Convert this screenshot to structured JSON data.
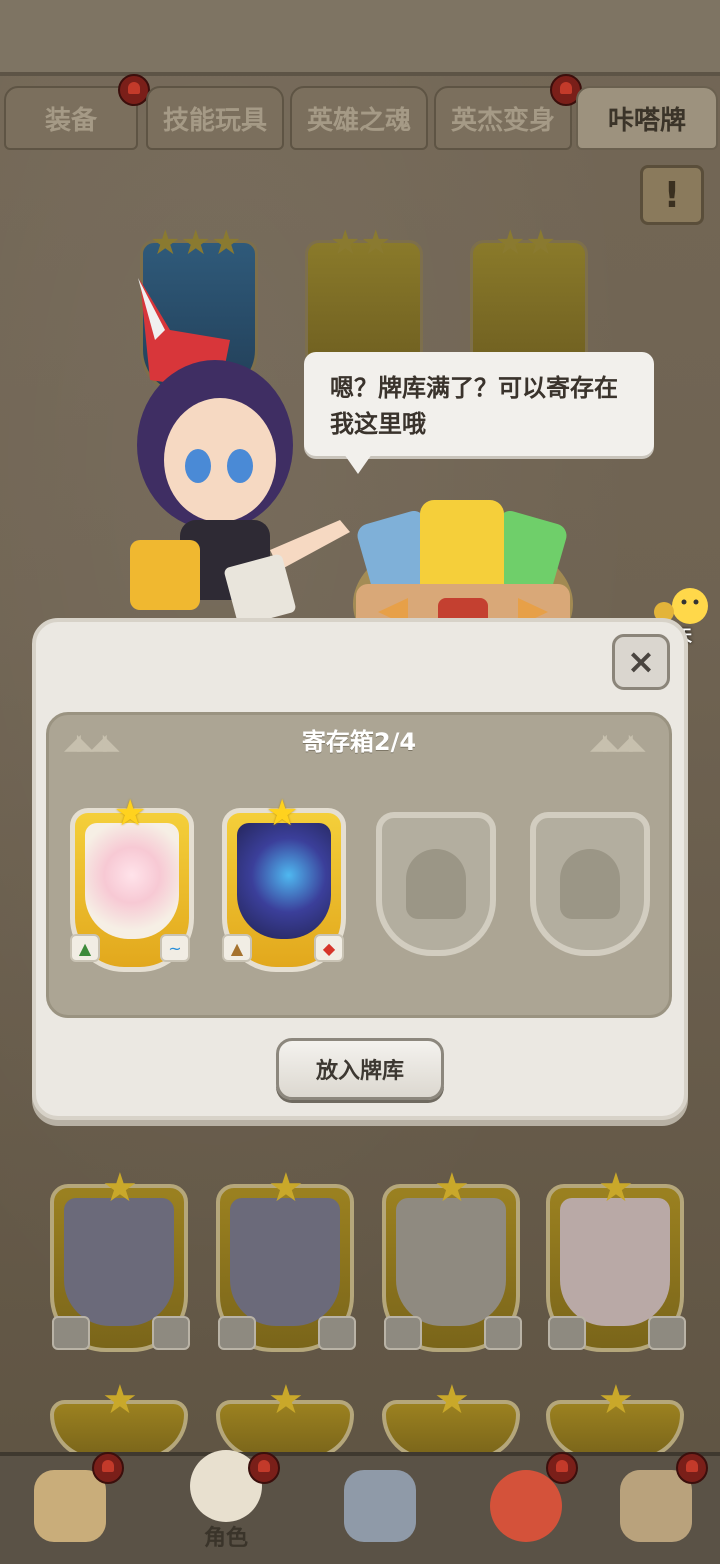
{
  "tabs": [
    {
      "label": "装备",
      "active": false,
      "notification": true
    },
    {
      "label": "技能玩具",
      "active": false,
      "notification": false
    },
    {
      "label": "英雄之魂",
      "active": false,
      "notification": false
    },
    {
      "label": "英杰变身",
      "active": false,
      "notification": true
    },
    {
      "label": "咔嗒牌",
      "active": true,
      "notification": false
    }
  ],
  "info_button": {
    "icon": "info-scroll-icon",
    "label": "!"
  },
  "npc": {
    "speech": "嗯？牌库满了？可以寄存在我这里哦"
  },
  "chat": {
    "label": "聊天",
    "icon": "chat-bubble-icon"
  },
  "dialog": {
    "close_label": "×",
    "storage_title": "寄存箱2/4",
    "slots": [
      {
        "filled": true,
        "stars": 1,
        "element_left": "forest",
        "element_right": "water",
        "creature": "pink-bird",
        "colors": {
          "art": "#f6efe5"
        }
      },
      {
        "filled": true,
        "stars": 1,
        "element_left": "earth",
        "element_right": "fire",
        "creature": "blue-dragon",
        "colors": {
          "art": "#3b3f9a"
        }
      },
      {
        "filled": false
      },
      {
        "filled": false
      }
    ],
    "put_button": "放入牌库"
  },
  "bottom_nav": {
    "items": [
      {
        "icon": "caveman-icon",
        "notification": true
      },
      {
        "icon": "character-icon",
        "label": "角色",
        "notification": true,
        "active": true
      },
      {
        "icon": "weapon-icon",
        "notification": false
      },
      {
        "icon": "pet-icon",
        "notification": true
      },
      {
        "icon": "shop-icon",
        "notification": true
      }
    ]
  },
  "colors": {
    "gold": "#f4cf3a",
    "dialog_bg": "#ebe8e2",
    "panel": "#aca594"
  }
}
